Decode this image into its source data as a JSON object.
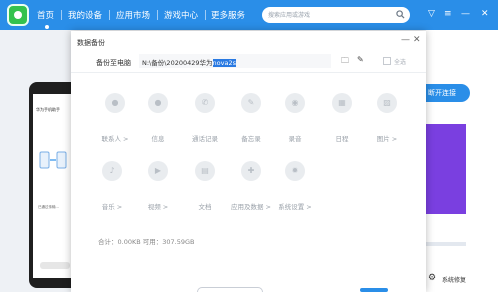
{
  "nav": {
    "items": [
      "首页",
      "我的设备",
      "应用市场",
      "游戏中心",
      "更多服务"
    ]
  },
  "search": {
    "placeholder": "搜索应用或游戏"
  },
  "window_icons": {
    "more": "▽",
    "menu": "≡",
    "minimize": "—",
    "close": "✕"
  },
  "device_preview": {
    "title": "华为手机助手",
    "subtitle": "",
    "note": "已通过传输..."
  },
  "right": {
    "connect_button": "断开连接",
    "repair_label": "系统修复",
    "repair_icon": "⚙"
  },
  "dialog": {
    "title": "数据备份",
    "minimize": "—",
    "close": "✕",
    "path_label": "备份至电脑",
    "path_prefix": "N:\\备份\\20200429华为",
    "path_selected": "nova2s",
    "select_all_label": "全选",
    "categories": [
      {
        "label": "联系人 >",
        "icon": "●"
      },
      {
        "label": "信息",
        "icon": "●"
      },
      {
        "label": "通话记录",
        "icon": "✆"
      },
      {
        "label": "备忘录",
        "icon": "✎"
      },
      {
        "label": "录音",
        "icon": "◉"
      },
      {
        "label": "日程",
        "icon": "▦"
      },
      {
        "label": "图片 >",
        "icon": "▨"
      },
      {
        "label": "音乐 >",
        "icon": "♪"
      },
      {
        "label": "视频 >",
        "icon": "▶"
      },
      {
        "label": "文档",
        "icon": "▤"
      },
      {
        "label": "应用及数据 >",
        "icon": "✚"
      },
      {
        "label": "系统设置 >",
        "icon": "✹"
      }
    ],
    "usage_text": "合计：0.00KB   可用：307.59GB"
  },
  "colors": {
    "brand": "#2a8ee8",
    "selection": "#2a7ae2",
    "promo": "#7a3fe0"
  }
}
